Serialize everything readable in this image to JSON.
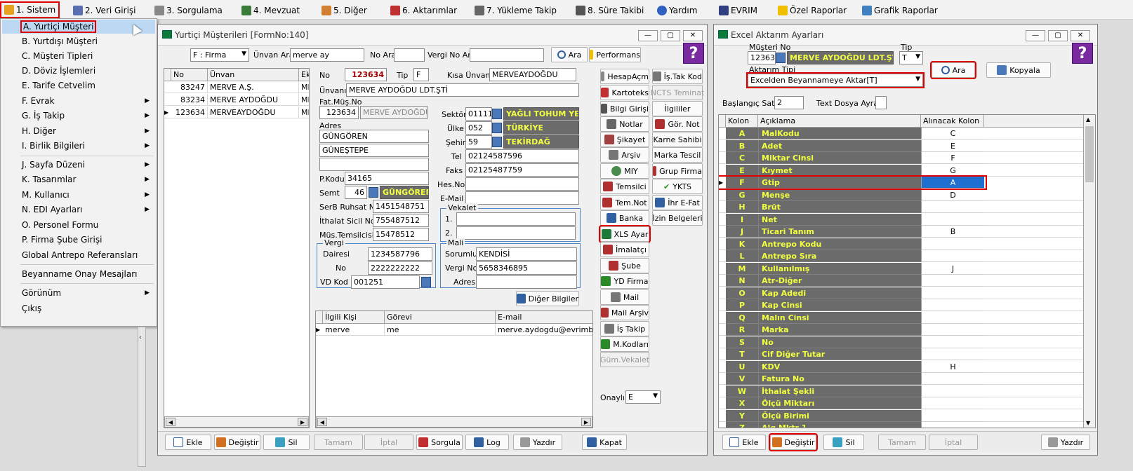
{
  "menubar": {
    "items": [
      "1. Sistem",
      "2. Veri Girişi",
      "3. Sorgulama",
      "4. Mevzuat",
      "5. Diğer",
      "6. Aktarımlar",
      "7. Yükleme Takip",
      "8. Süre Takibi",
      "Yardım",
      "EVRIM",
      "Özel Raporlar",
      "Grafik Raporlar"
    ]
  },
  "sistem_menu": {
    "items": [
      "A. Yurtiçi Müşteri",
      "B. Yurtdışı Müşteri",
      "C. Müşteri Tipleri",
      "D. Döviz İşlemleri",
      "E. Tarife Cetvelim",
      "F. Evrak",
      "G. İş Takip",
      "H. Diğer",
      "I. Birlik Bilgileri",
      "J. Sayfa Düzeni",
      "K. Tasarımlar",
      "M. Kullanıcı",
      "N. EDI Ayarları",
      "O. Personel Formu",
      "P. Firma Şube Girişi",
      "Global Antrepo Referansları",
      "Beyanname Onay Mesajları",
      "Görünüm",
      "Çıkış"
    ]
  },
  "customer_window": {
    "title": "Yurtiçi Müşterileri [FormNo:140]",
    "search": {
      "type_value": "F : Firma",
      "unvan_label": "Ünvan Ara",
      "unvan_value": "merve ay",
      "no_label": "No Ara",
      "vergi_label": "Vergi No Ara",
      "ara_button": "Ara",
      "performans_button": "Performans"
    },
    "list": {
      "headers": [
        "No",
        "Ünvan",
        "Ek"
      ],
      "rows": [
        {
          "no": "83247",
          "unvan": "MERVE A.Ş.",
          "ek": "ME"
        },
        {
          "no": "83234",
          "unvan": "MERVE AYDOĞDU",
          "ek": "ME"
        },
        {
          "no": "123634",
          "unvan": "MERVEAYDOĞDU",
          "ek": "ME"
        }
      ]
    },
    "form": {
      "no_label": "No",
      "no_value": "123634",
      "tip_label": "Tip",
      "tip_value": "F",
      "kisa_label": "Kısa Ünvanı",
      "kisa_value": "MERVEAYDOĞDU",
      "unvan_label": "Ünvanı",
      "unvan_value": "MERVE AYDOĞDU LDT.ŞTİ",
      "fatmus_label": "Fat.Müş.No",
      "fatmus_no": "123634",
      "fatmus_name": "MERVE AYDOĞDU",
      "adres_label": "Adres",
      "adres1": "GÜNGÖREN",
      "adres2": "GÜNEŞTEPE",
      "adres3": "",
      "pkodu_label": "P.Kodu",
      "pkodu_value": "34165",
      "semt_label": "Semt",
      "semt_code": "46",
      "semt_name": "GÜNGÖREN",
      "serb_label": "SerB Ruhsat No",
      "serb_value": "1451548751",
      "ithalat_label": "İthalat Sicil No",
      "ithalat_value": "755487512",
      "mustem_label": "Müş.Temsilcisi 2",
      "mustem_value": "15478512",
      "sektor_label": "Sektör",
      "sektor_code": "01111-",
      "sektor_name": "YAĞLI TOHUM YET",
      "ulke_label": "Ülke",
      "ulke_code": "052",
      "ulke_name": "TÜRKİYE",
      "sehir_label": "Şehir",
      "sehir_code": "59",
      "sehir_name": "TEKİRDAĞ",
      "tel_label": "Tel",
      "tel_value": "02124587596",
      "faks_label": "Faks",
      "faks_value": "02125487759",
      "hesno_label": "Hes.No",
      "hesno_value": "",
      "email_label": "E-Mail",
      "email_value": "",
      "vekalet_title": "Vekalet",
      "vekalet1": "1.",
      "vekalet2": "2.",
      "vergi_title": "Vergi",
      "dairesi_label": "Dairesi",
      "dairesi_value": "1234587796",
      "vno_label": "No",
      "vno_value": "2222222222",
      "vdkod_label": "VD Kod",
      "vdkod_value": "001251",
      "mali_title": "Mali",
      "sorumlu_label": "Sorumlu",
      "sorumlu_value": "KENDİSİ",
      "malivno_label": "Vergi No",
      "malivno_value": "5658346895",
      "maliadres_label": "Adres",
      "maliadres_value": "",
      "diger_button": "Diğer Bilgiler"
    },
    "contacts": {
      "headers": [
        "İlgili Kişi",
        "Görevi",
        "E-mail"
      ],
      "rows": [
        {
          "kisi": "merve",
          "gorev": "me",
          "email": "merve.aydogdu@evrimbilgisay"
        }
      ]
    },
    "side_buttons": {
      "col1": [
        "HesapAçm",
        "Kartoteks",
        "Bilgi Girişi",
        "Notlar",
        "Şikayet",
        "Arşiv",
        "MIY",
        "Temsilci",
        "Tem.Not",
        "Banka",
        "XLS Ayar",
        "İmalatçı",
        "Şube",
        "YD Firma",
        "Mail",
        "Mail Arşiv",
        "İş Takip",
        "M.Kodları",
        "Güm.Vekalet"
      ],
      "col2": [
        "İş.Tak Kod",
        "NCTS Teminat",
        "İlgililer",
        "Gör. Not",
        "Karne Sahibi",
        "Marka Tescil",
        "Grup Firma",
        "YKTS",
        "İhr E-Fat",
        "İzin Belgeleri"
      ]
    },
    "onayli_label": "Onaylı",
    "onayli_value": "E",
    "bottom": {
      "ekle": "Ekle",
      "degistir": "Değiştir",
      "sil": "Sil",
      "tamam": "Tamam",
      "iptal": "İptal",
      "sorgula": "Sorgula",
      "log": "Log",
      "yazdir": "Yazdır",
      "kapat": "Kapat"
    }
  },
  "excel_window": {
    "title": "Excel Aktarım Ayarları",
    "musteri_label": "Müşteri No",
    "musteri_no": "12363",
    "musteri_name": "MERVE AYDOĞDU LDT.ŞTİ",
    "tip_label": "Tip",
    "tip_value": "T",
    "aktarim_label": "Aktarım Tipi",
    "aktarim_value": "Excelden Beyannameye Aktar[T]",
    "ara_button": "Ara",
    "kopyala_button": "Kopyala",
    "baslangic_label": "Başlangıç Satır",
    "baslangic_value": "2",
    "ayrac_label": "Text Dosya Ayraç",
    "ayrac_value": "",
    "headers": [
      "Kolon",
      "Açıklama",
      "Alınacak Kolon"
    ],
    "rows": [
      {
        "k": "A",
        "a": "MalKodu",
        "v": "C"
      },
      {
        "k": "B",
        "a": "Adet",
        "v": "E"
      },
      {
        "k": "C",
        "a": "Miktar Cinsi",
        "v": "F"
      },
      {
        "k": "E",
        "a": "Kıymet",
        "v": "G"
      },
      {
        "k": "F",
        "a": "Gtip",
        "v": "A"
      },
      {
        "k": "G",
        "a": "Menşe",
        "v": "D"
      },
      {
        "k": "H",
        "a": "Brüt",
        "v": ""
      },
      {
        "k": "I",
        "a": "Net",
        "v": ""
      },
      {
        "k": "J",
        "a": "Ticari Tanım",
        "v": "B"
      },
      {
        "k": "K",
        "a": "Antrepo Kodu",
        "v": ""
      },
      {
        "k": "L",
        "a": "Antrepo Sıra",
        "v": ""
      },
      {
        "k": "M",
        "a": "Kullanılmış",
        "v": "J"
      },
      {
        "k": "N",
        "a": "Atr-Diğer",
        "v": ""
      },
      {
        "k": "O",
        "a": "Kap Adedi",
        "v": ""
      },
      {
        "k": "P",
        "a": "Kap Cinsi",
        "v": ""
      },
      {
        "k": "Q",
        "a": "Malın Cinsi",
        "v": ""
      },
      {
        "k": "R",
        "a": "Marka",
        "v": ""
      },
      {
        "k": "S",
        "a": "No",
        "v": ""
      },
      {
        "k": "T",
        "a": "Cif Diğer Tutar",
        "v": ""
      },
      {
        "k": "U",
        "a": "KDV",
        "v": "H"
      },
      {
        "k": "V",
        "a": "Fatura No",
        "v": ""
      },
      {
        "k": "W",
        "a": "İthalat Şekli",
        "v": ""
      },
      {
        "k": "X",
        "a": "Ölçü Miktarı",
        "v": ""
      },
      {
        "k": "Y",
        "a": "Ölçü Birimi",
        "v": ""
      },
      {
        "k": "Z",
        "a": "Alg Mktr 1",
        "v": ""
      }
    ],
    "bottom": {
      "ekle": "Ekle",
      "degistir": "Değiştir",
      "sil": "Sil",
      "tamam": "Tamam",
      "iptal": "İptal",
      "yazdir": "Yazdır"
    }
  }
}
